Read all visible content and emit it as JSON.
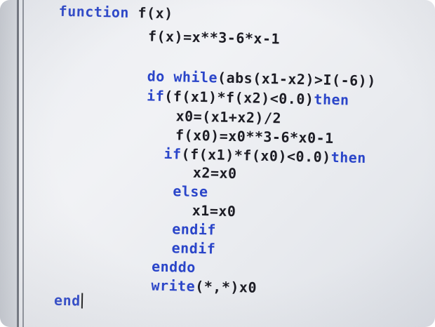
{
  "editor": {
    "lines": [
      {
        "kw": "function",
        "tx": " f(x)"
      },
      {
        "kw": "",
        "tx": "f(x)=x**3-6*x-1"
      },
      {
        "kw": "do while",
        "tx": "(abs(x1-x2)>I(-6))"
      },
      {
        "kw": "if",
        "tx": "(f(x1)*f(x2)<0.0)",
        "kw2": "then"
      },
      {
        "kw": "",
        "tx": "x0=(x1+x2)/2"
      },
      {
        "kw": "",
        "tx": "f(x0)=x0**3-6*x0-1"
      },
      {
        "kw": "if",
        "tx": "(f(x1)*f(x0)<0.0)",
        "kw2": "then"
      },
      {
        "kw": "",
        "tx": "x2=x0"
      },
      {
        "kw": "else",
        "tx": ""
      },
      {
        "kw": "",
        "tx": "x1=x0"
      },
      {
        "kw": "endif",
        "tx": ""
      },
      {
        "kw": "endif",
        "tx": ""
      },
      {
        "kw": "enddo",
        "tx": ""
      },
      {
        "kw": "write",
        "tx": "(*,*)x0"
      },
      {
        "kw": "end",
        "tx": ""
      }
    ]
  }
}
